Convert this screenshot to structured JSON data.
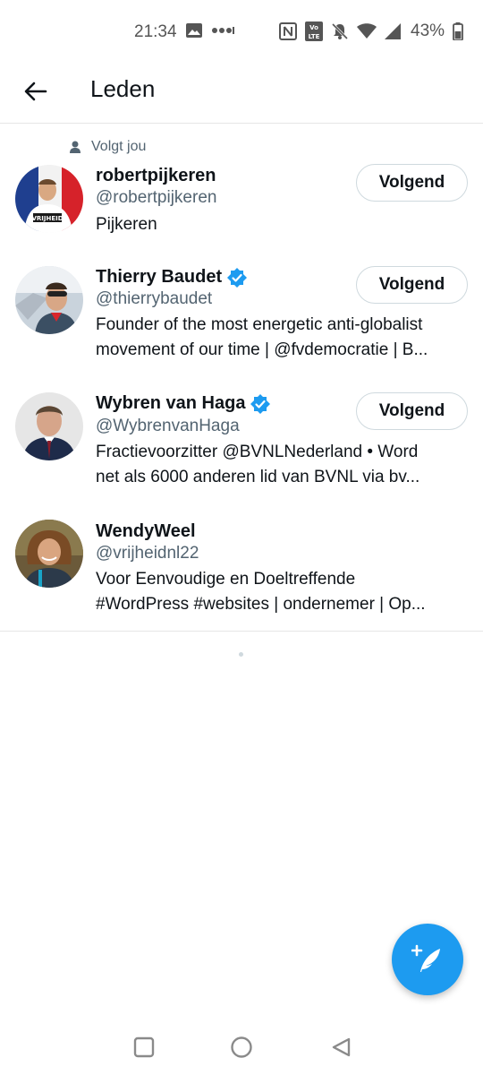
{
  "status_bar": {
    "time": "21:34",
    "battery_percent": "43%",
    "icons": [
      "image-icon",
      "more-dots-icon",
      "nfc-icon",
      "volte-icon",
      "mute-icon",
      "wifi-icon",
      "signal-icon",
      "battery-icon"
    ]
  },
  "header": {
    "title": "Leden",
    "back_icon": "arrow-left-icon"
  },
  "members": [
    {
      "follows_you_label": "Volgt jou",
      "name": "robertpijkeren",
      "verified": false,
      "handle": "@robertpijkeren",
      "bio_lines": [
        "Pijkeren"
      ],
      "button_label": "Volgend"
    },
    {
      "name": "Thierry Baudet",
      "verified": true,
      "handle": "@thierrybaudet",
      "bio_lines": [
        "Founder of the most energetic anti-globalist",
        "movement of our time | @fvdemocratie | B..."
      ],
      "button_label": "Volgend"
    },
    {
      "name": "Wybren van Haga",
      "verified": true,
      "handle": "@WybrenvanHaga",
      "bio_lines": [
        "Fractievoorzitter @BVNLNederland • Word",
        "net als 6000 anderen lid van BVNL via bv..."
      ],
      "button_label": "Volgend"
    },
    {
      "name": "WendyWeel",
      "verified": false,
      "handle": "@vrijheidnl22",
      "bio_lines": [
        "Voor Eenvoudige en Doeltreffende",
        "#WordPress #websites  | ondernemer | Op..."
      ]
    }
  ],
  "fab": {
    "icon": "compose-tweet-icon"
  },
  "colors": {
    "accent": "#1d9bf0",
    "text": "#0f1419",
    "secondary": "#536471"
  }
}
